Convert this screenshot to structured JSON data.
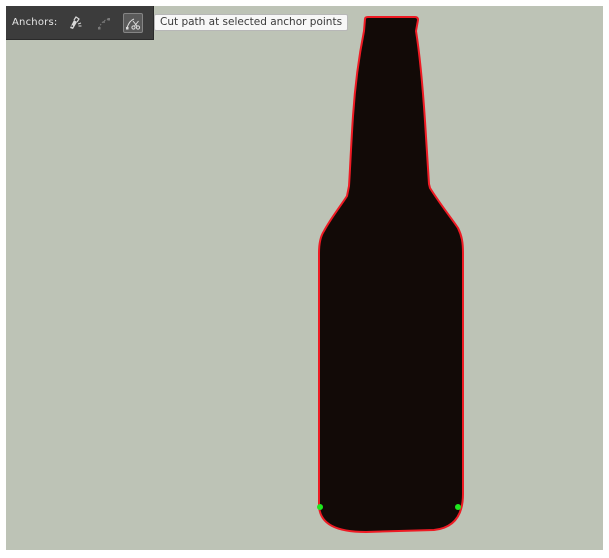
{
  "control_bar": {
    "anchors_label": "Anchors:",
    "background": "#3c3c3c",
    "tools": [
      {
        "id": "convert",
        "icon": "convert-anchor-pen-icon",
        "enabled": true,
        "selected": false
      },
      {
        "id": "handles",
        "icon": "anchor-handles-icon",
        "enabled": false,
        "selected": false
      },
      {
        "id": "cut",
        "icon": "cut-path-scissors-icon",
        "enabled": true,
        "selected": true
      }
    ]
  },
  "tooltip": {
    "text": "Cut path at selected anchor points"
  },
  "artboard": {
    "background": "#bdc3b6"
  },
  "bottle": {
    "fill": "#120a07",
    "stroke": "#ee1b24",
    "selected_anchor_color": "#1ee81e"
  }
}
